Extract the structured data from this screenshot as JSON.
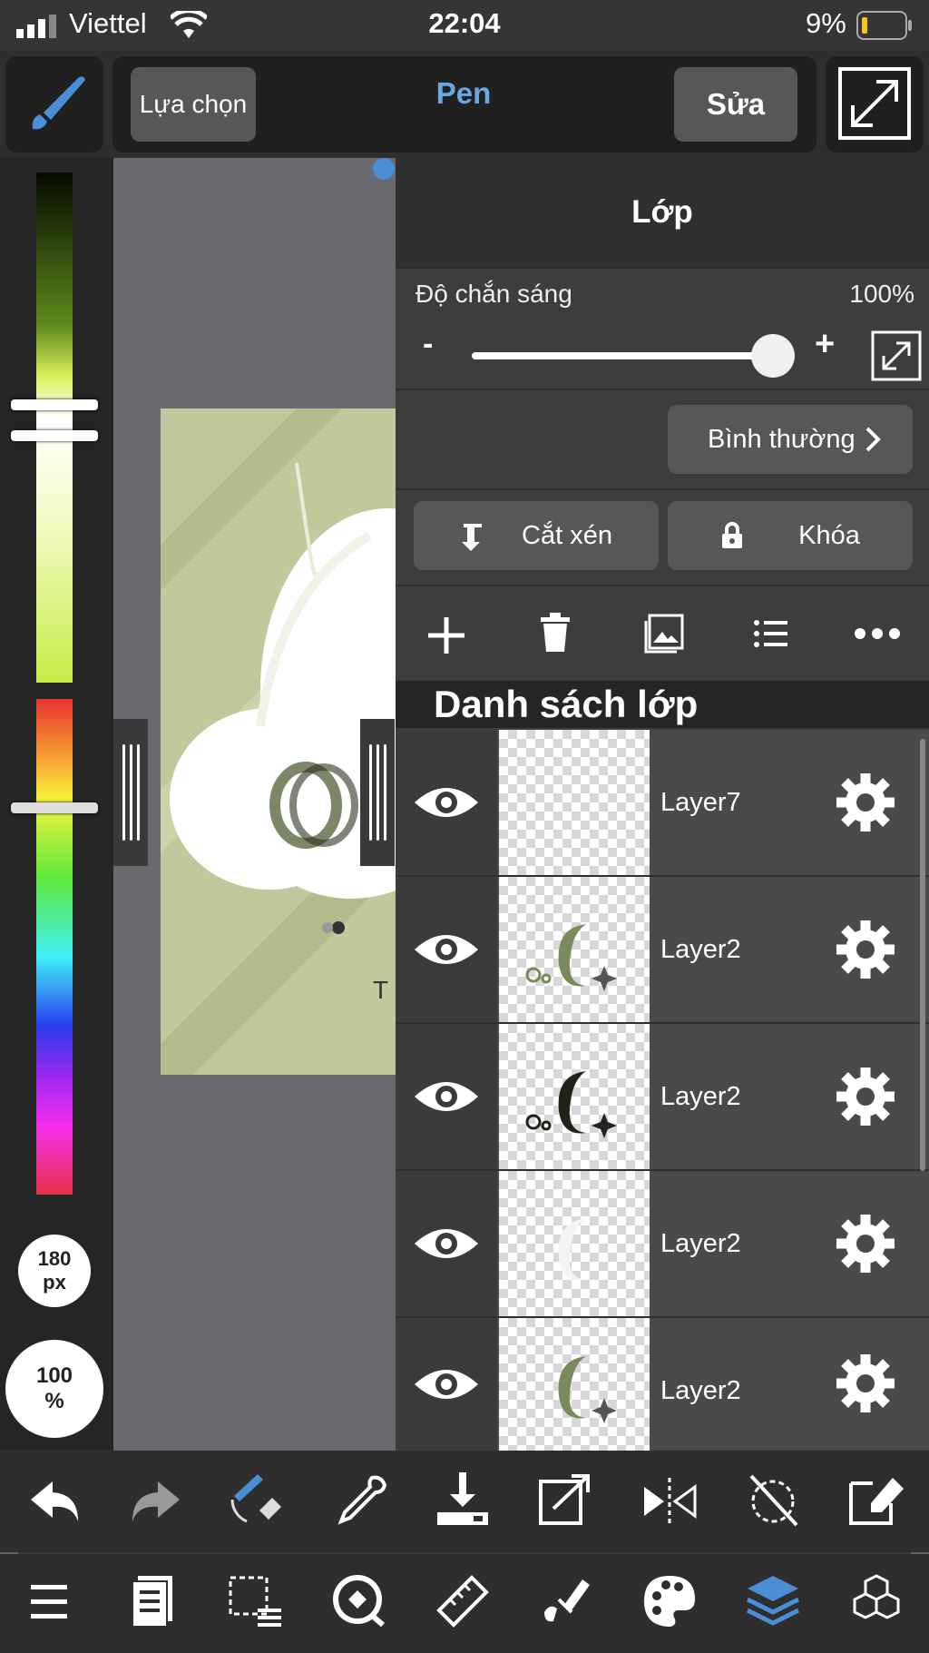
{
  "status_bar": {
    "carrier": "Viettel",
    "time": "22:04",
    "battery": "9%"
  },
  "toolbar": {
    "select_label": "Lựa chọn",
    "tool_name": "Pen",
    "edit_label": "Sửa"
  },
  "left_panel": {
    "brush_size": "180",
    "brush_size_unit": "px",
    "opacity": "100",
    "opacity_unit": "%"
  },
  "layer_panel": {
    "title": "Lớp",
    "opacity_label": "Độ chắn sáng",
    "opacity_value": "100%",
    "opacity_level": 1.0,
    "slider_minus": "-",
    "slider_plus": "+",
    "blend_mode": "Bình thường",
    "clip_label": "Cắt xén",
    "lock_label": "Khóa",
    "list_title": "Danh sách lớp",
    "layers": [
      {
        "name": "Layer7"
      },
      {
        "name": "Layer2"
      },
      {
        "name": "Layer2"
      },
      {
        "name": "Layer2"
      },
      {
        "name": "Layer2"
      }
    ]
  },
  "colors": {
    "accent": "#4a8fd6",
    "panel": "#3d3d3d",
    "row": "#4a4a4a",
    "canvas_art": "#c2cc9f"
  }
}
